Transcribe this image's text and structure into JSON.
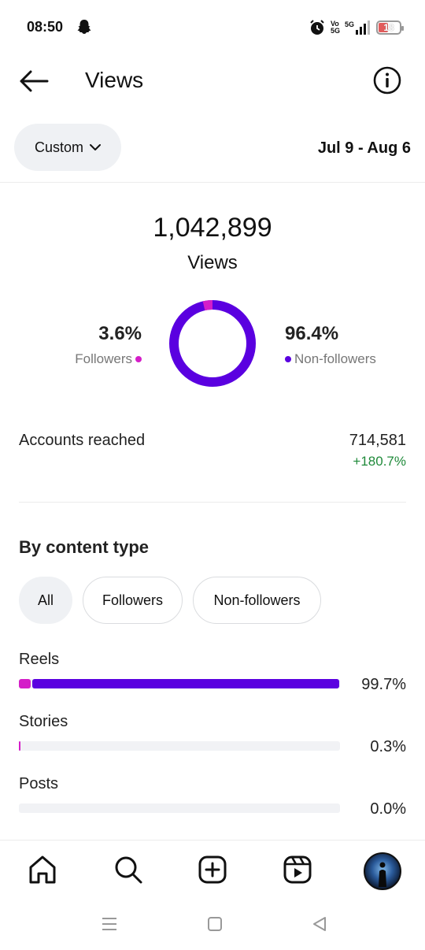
{
  "status_bar": {
    "time": "08:50",
    "network_labels": [
      "Vo",
      "5G",
      "5G"
    ],
    "battery": "18"
  },
  "header": {
    "title": "Views"
  },
  "filter": {
    "period_label": "Custom",
    "date_range": "Jul 9 - Aug 6"
  },
  "summary": {
    "total_views": "1,042,899",
    "views_label": "Views",
    "followers_pct": "3.6%",
    "followers_label": "Followers",
    "nonfollowers_pct": "96.4%",
    "nonfollowers_label": "Non-followers",
    "followers_share": 0.036,
    "nonfollowers_share": 0.964
  },
  "accounts_reached": {
    "label": "Accounts reached",
    "value": "714,581",
    "change": "+180.7%"
  },
  "content_type": {
    "title": "By content type",
    "chips": [
      "All",
      "Followers",
      "Non-followers"
    ],
    "rows": [
      {
        "label": "Reels",
        "pct": "99.7%",
        "followers_share": 0.036,
        "nonfollowers_share": 0.961
      },
      {
        "label": "Stories",
        "pct": "0.3%",
        "followers_share": 0.003,
        "nonfollowers_share": 0.0
      },
      {
        "label": "Posts",
        "pct": "0.0%",
        "followers_share": 0.0,
        "nonfollowers_share": 0.0
      }
    ]
  },
  "colors": {
    "followers": "#d41ec8",
    "nonfollowers": "#5a00e0",
    "positive_change": "#1f8a3a"
  },
  "icons": {
    "back": "arrow-left-icon",
    "info": "info-icon",
    "chevron": "chevron-down-icon",
    "nav": [
      "home-icon",
      "search-icon",
      "create-post-icon",
      "reels-icon",
      "profile-avatar"
    ],
    "system": [
      "recent-apps-icon",
      "home-square-icon",
      "back-triangle-icon"
    ]
  }
}
